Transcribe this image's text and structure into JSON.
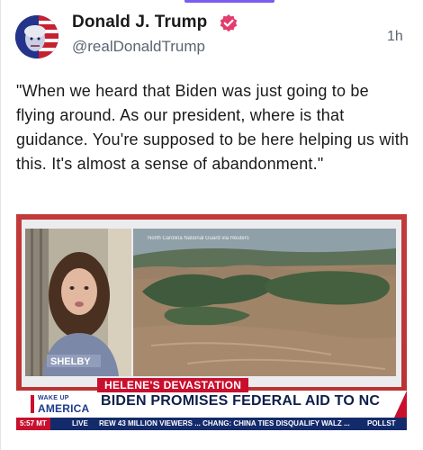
{
  "post": {
    "author_name": "Donald J. Trump",
    "handle": "@realDonaldTrump",
    "timestamp": "1h",
    "text": "\"When we heard that Biden was just going to be flying around. As our president, where is that guidance. You're supposed to be here helping us with this. It's almost a sense of abandonment.\"",
    "accent_color": "#7b5cf0",
    "verified_icon": "verified-badge-icon"
  },
  "media": {
    "tag": "HELENE'S DEVASTATION",
    "brand_small": "WAKE UP",
    "brand_big": "AMERICA",
    "headline": "BIDEN PROMISES FEDERAL AID TO NC",
    "shirt_text": "SHELBY",
    "video_caption": "North Carolina National Guard via Reuters",
    "ticker": {
      "time": "5:57 MT",
      "live": "LIVE",
      "crawl": "REW 43 MILLION VIEWERS ...   CHANG: CHINA TIES DISQUALIFY WALZ ...",
      "right": "POLLST"
    },
    "colors": {
      "brand_red": "#c8102e",
      "brand_navy": "#142b6b"
    }
  }
}
